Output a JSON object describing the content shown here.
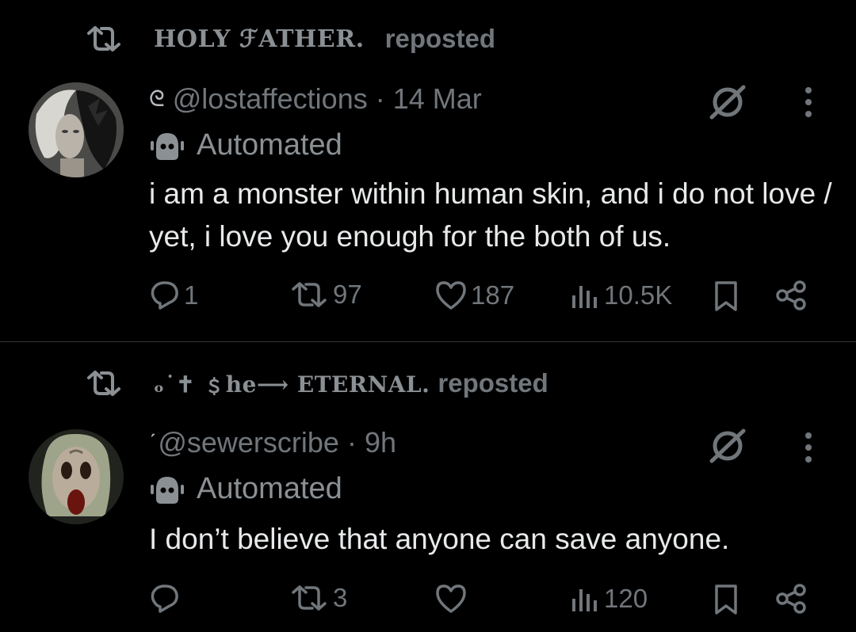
{
  "posts": [
    {
      "reposted_by": "HOLY ℱATHER.",
      "repost_label": "reposted",
      "handle_prefix": "ᘓ",
      "handle": "@lostaffections",
      "separator": "·",
      "time": "14 Mar",
      "automated_label": "Automated",
      "text": "i am a monster within human skin, and i do not love / yet, i love you enough for the both of us.",
      "replies": "1",
      "reposts": "97",
      "likes": "187",
      "views": "10.5K"
    },
    {
      "reposted_by": "ₒ˙✝ ﹩he⟶ ETERNAL.",
      "repost_label": "reposted",
      "handle_prefix": "ˊ",
      "handle": "@sewerscribe",
      "separator": "·",
      "time": "9h",
      "automated_label": "Automated",
      "text": "I don’t believe that anyone can save anyone.",
      "replies": "",
      "reposts": "3",
      "likes": "",
      "views": "120"
    }
  ],
  "icons": {
    "repost": "repost-icon",
    "reply": "reply-icon",
    "like": "heart-icon",
    "views": "views-chart-icon",
    "bookmark": "bookmark-icon",
    "share": "share-icon",
    "grok": "grok-icon",
    "more": "more-vertical-icon",
    "automated": "bot-icon"
  },
  "colors": {
    "background": "#000000",
    "text_primary": "#e7e9ea",
    "text_secondary": "#71767b",
    "divider": "#2f3336"
  }
}
